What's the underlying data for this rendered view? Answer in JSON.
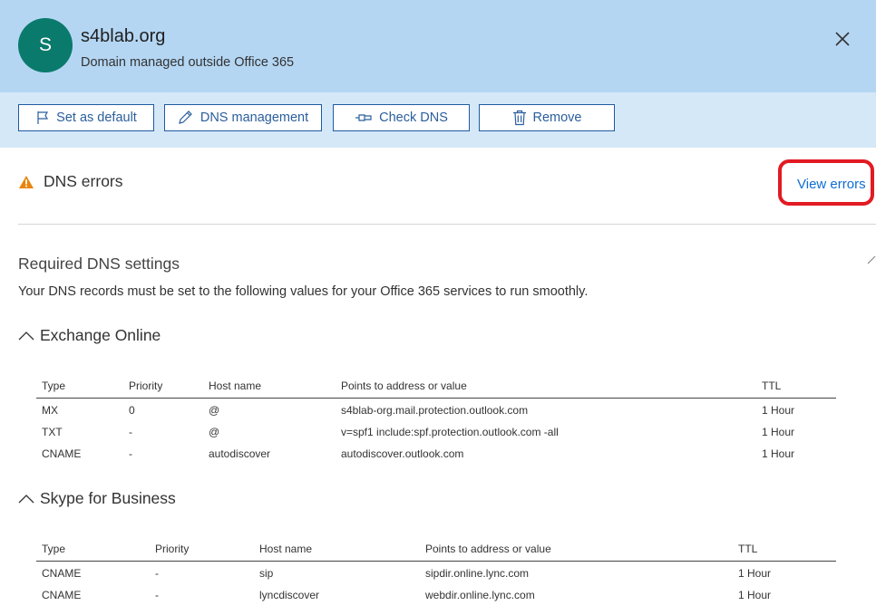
{
  "header": {
    "avatar_letter": "S",
    "title": "s4blab.org",
    "subtitle": "Domain managed outside Office 365"
  },
  "toolbar": {
    "set_default": "Set as default",
    "dns_management": "DNS management",
    "check_dns": "Check DNS",
    "remove": "Remove"
  },
  "status": {
    "label": "DNS errors",
    "link": "View errors"
  },
  "required": {
    "title": "Required DNS settings",
    "description": "Your DNS records must be set to the following values for your Office 365 services to run smoothly."
  },
  "exchange": {
    "title": "Exchange Online",
    "columns": [
      "Type",
      "Priority",
      "Host name",
      "Points to address or value",
      "TTL"
    ],
    "rows": [
      [
        "MX",
        "0",
        "@",
        "s4blab-org.mail.protection.outlook.com",
        "1 Hour"
      ],
      [
        "TXT",
        "-",
        "@",
        "v=spf1 include:spf.protection.outlook.com -all",
        "1 Hour"
      ],
      [
        "CNAME",
        "-",
        "autodiscover",
        "autodiscover.outlook.com",
        "1 Hour"
      ]
    ]
  },
  "skype": {
    "title": "Skype for Business",
    "columns": [
      "Type",
      "Priority",
      "Host name",
      "Points to address or value",
      "TTL"
    ],
    "rows": [
      [
        "CNAME",
        "-",
        "sip",
        "sipdir.online.lync.com",
        "1 Hour"
      ],
      [
        "CNAME",
        "-",
        "lyncdiscover",
        "webdir.online.lync.com",
        "1 Hour"
      ]
    ]
  },
  "colors": {
    "header_bg": "#b4d6f3",
    "toolbar_bg": "#d5e8f8",
    "avatar": "#0a7a6c",
    "link": "#0f6ed3",
    "warning": "#e8850c",
    "highlight": "#e21a23"
  }
}
